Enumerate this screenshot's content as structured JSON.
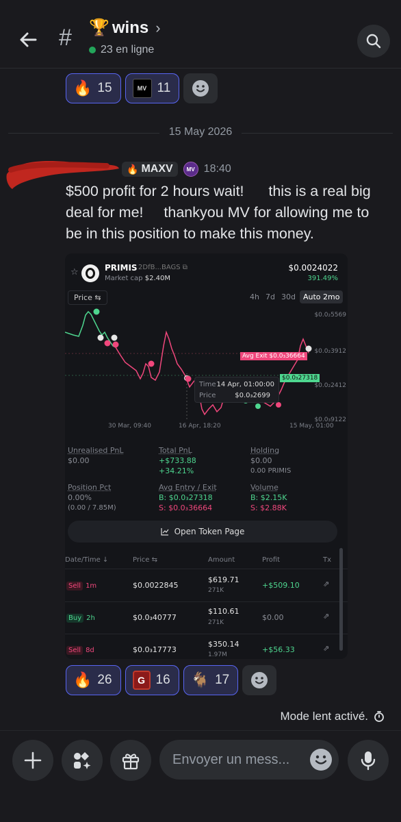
{
  "header": {
    "channel_emoji": "🏆",
    "channel_name": "wins",
    "online_text": "23 en ligne"
  },
  "top_reactions": [
    {
      "emoji": "🔥",
      "count": "15"
    },
    {
      "emoji": "MV",
      "count": "11"
    }
  ],
  "date_divider": "15 May 2026",
  "message": {
    "role_emoji": "🔥",
    "role_tag": "MAXV",
    "badge_text": "MV",
    "time": "18:40",
    "text": "$500 profit for 2 hours wait!      this is a real big deal for me!     thankyou MV for allowing me to be in this position to make this money."
  },
  "embed": {
    "token_name": "PRIMIS",
    "token_addr": "2DfB...BAGS",
    "market_cap_label": "Market cap",
    "market_cap": "$2.40M",
    "price": "$0.0024022",
    "change": "391.49%",
    "price_btn": "Price ⇆",
    "timeframes": [
      "4h",
      "7d",
      "30d",
      "Auto 2mo"
    ],
    "active_timeframe": 3,
    "y_ticks": [
      "$0.0₂5569",
      "$0.0₂3912",
      "$0.0₂2412",
      "$0.0₃9122"
    ],
    "x_ticks": [
      "30 Mar, 09:40",
      "16 Apr, 18:20",
      "15 May, 01:00"
    ],
    "avg_exit_label": "Avg Exit $0.0₃36664",
    "avg_entry_label": "$0.0₃27318",
    "tooltip": {
      "time_label": "Time",
      "time": "14 Apr, 01:00:00",
      "price_label": "Price",
      "price": "$0.0₃2699"
    },
    "stats": {
      "unrealised_label": "Unrealised PnL",
      "unrealised": "$0.00",
      "total_label": "Total PnL",
      "total": "+$733.88",
      "total_pct": "+34.21%",
      "holding_label": "Holding",
      "holding": "$0.00",
      "holding_sub": "0.00 PRIMIS",
      "pos_label": "Position Pct",
      "pos": "0.00%",
      "pos_sub": "(0.00 / 7.85M)",
      "avg_label": "Avg Entry / Exit",
      "avg_b": "B: $0.0₃27318",
      "avg_s": "S: $0.0₃36664",
      "vol_label": "Volume",
      "vol_b": "B: $2.15K",
      "vol_s": "S: $2.88K"
    },
    "open_token": "Open Token Page",
    "table": {
      "headers": [
        "Date/Time ↓",
        "Price ⇆",
        "Amount",
        "Profit",
        "Tx"
      ],
      "rows": [
        {
          "type": "Sell",
          "age": "1m",
          "price": "$0.0022845",
          "amount": "$619.71",
          "amount_sub": "271K",
          "profit": "+$509.10"
        },
        {
          "type": "Buy",
          "age": "2h",
          "price": "$0.0₃40777",
          "amount": "$110.61",
          "amount_sub": "271K",
          "profit": "$0.00"
        },
        {
          "type": "Sell",
          "age": "8d",
          "price": "$0.0₃17773",
          "amount": "$350.14",
          "amount_sub": "1.97M",
          "profit": "+$56.33"
        }
      ]
    }
  },
  "bottom_reactions": [
    {
      "emoji": "🔥",
      "count": "26"
    },
    {
      "emoji": "G",
      "count": "16"
    },
    {
      "emoji": "🐐",
      "count": "17"
    }
  ],
  "slow_mode": "Mode lent activé.",
  "composer_placeholder": "Envoyer un mess..."
}
